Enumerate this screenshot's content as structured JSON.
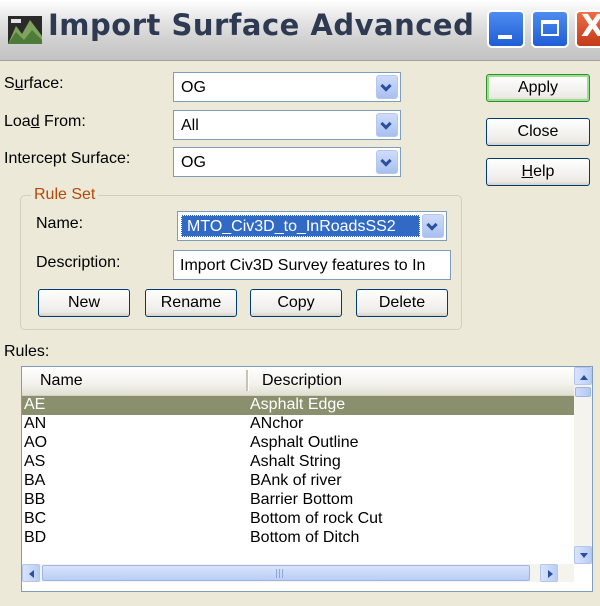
{
  "window": {
    "title": "Import Surface Advanced"
  },
  "form": {
    "surface_label_pre": "S",
    "surface_label_u": "u",
    "surface_label_post": "rface:",
    "surface_value": "OG",
    "load_from_label_pre": "Loa",
    "load_from_label_u": "d",
    "load_from_label_post": " From:",
    "load_from_value": "All",
    "intercept_label": "Intercept Surface:",
    "intercept_value": "OG"
  },
  "ruleset": {
    "legend": "Rule Set",
    "name_label": "Name:",
    "name_value": "MTO_Civ3D_to_InRoadsSS2",
    "description_label": "Description:",
    "description_value": "Import Civ3D Survey features to In",
    "buttons": {
      "new": "New",
      "rename": "Rename",
      "copy": "Copy",
      "delete": "Delete"
    }
  },
  "side_buttons": {
    "apply": "Apply",
    "close": "Close",
    "help_u": "H",
    "help_rest": "elp"
  },
  "rules": {
    "label": "Rules:",
    "columns": [
      "Name",
      "Description"
    ],
    "rows": [
      {
        "name": "AE",
        "description": "Asphalt Edge",
        "selected": true
      },
      {
        "name": "AN",
        "description": "ANchor"
      },
      {
        "name": "AO",
        "description": "Asphalt Outline"
      },
      {
        "name": "AS",
        "description": "Ashalt String"
      },
      {
        "name": "BA",
        "description": "BAnk of river"
      },
      {
        "name": "BB",
        "description": "Barrier Bottom"
      },
      {
        "name": "BC",
        "description": "Bottom of rock Cut"
      },
      {
        "name": "BD",
        "description": "Bottom of Ditch"
      }
    ]
  },
  "colors": {
    "window_bg": "#ece9d8",
    "selected_row": "#8a8f6d",
    "legend_text": "#b14a08",
    "title_text": "#2d3a52"
  }
}
